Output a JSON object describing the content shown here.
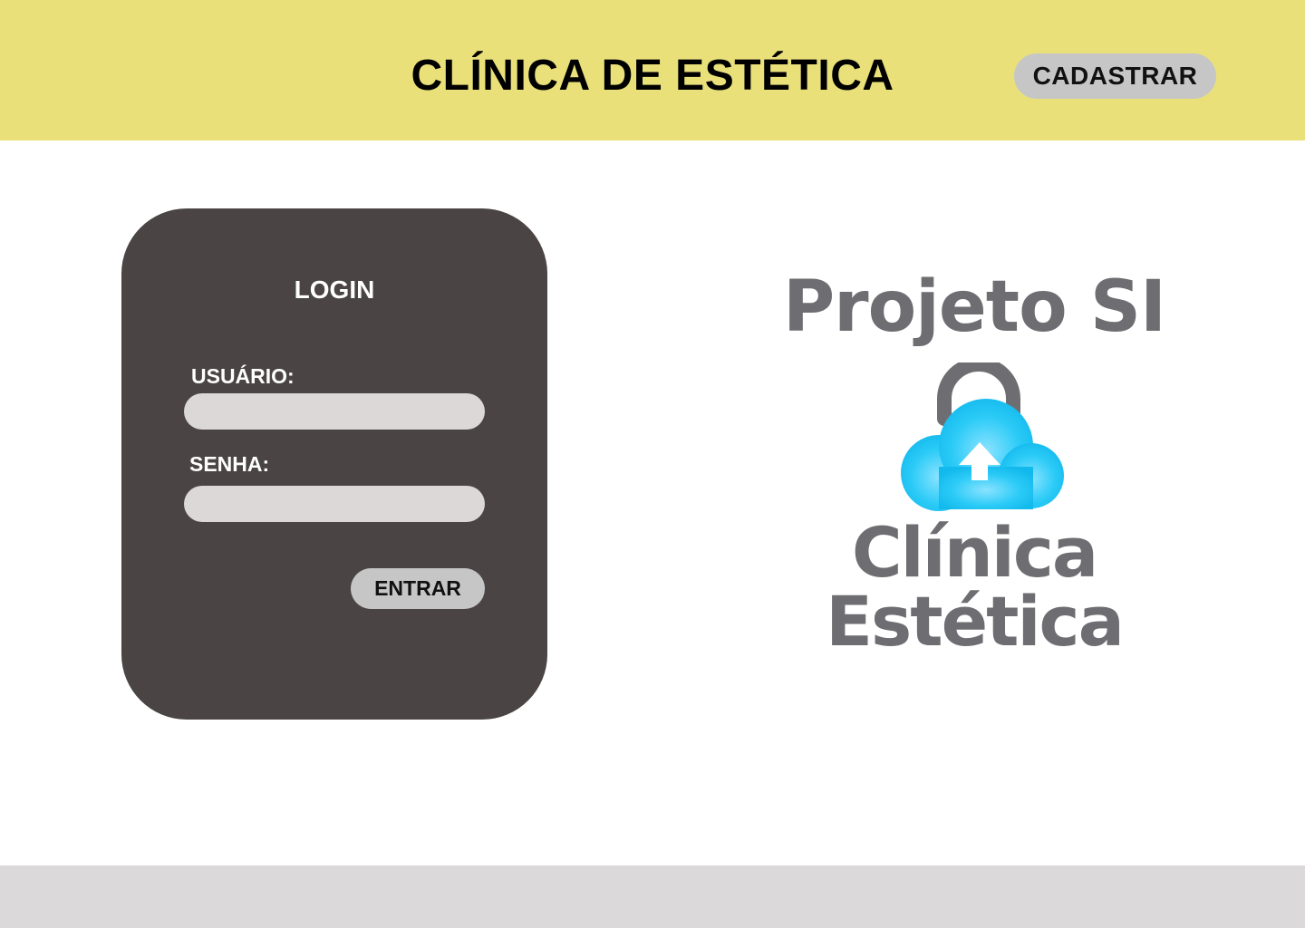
{
  "header": {
    "title": "CLÍNICA DE ESTÉTICA",
    "register_label": "CADASTRAR"
  },
  "login": {
    "title": "LOGIN",
    "user_label": "USUÁRIO:",
    "user_value": "",
    "password_label": "SENHA:",
    "password_value": "",
    "submit_label": "ENTRAR"
  },
  "logo": {
    "line1": "Projeto SI",
    "line2": "Clínica Estética",
    "icon": "cloud-upload-lock-icon"
  },
  "colors": {
    "header_bg": "#e9e07a",
    "card_bg": "#4a4444",
    "button_bg": "#c6c6c6",
    "input_bg": "#dcd8d8",
    "footer_bg": "#dbd9da",
    "logo_text": "#6e6e72",
    "cloud": "#25c8f5"
  }
}
